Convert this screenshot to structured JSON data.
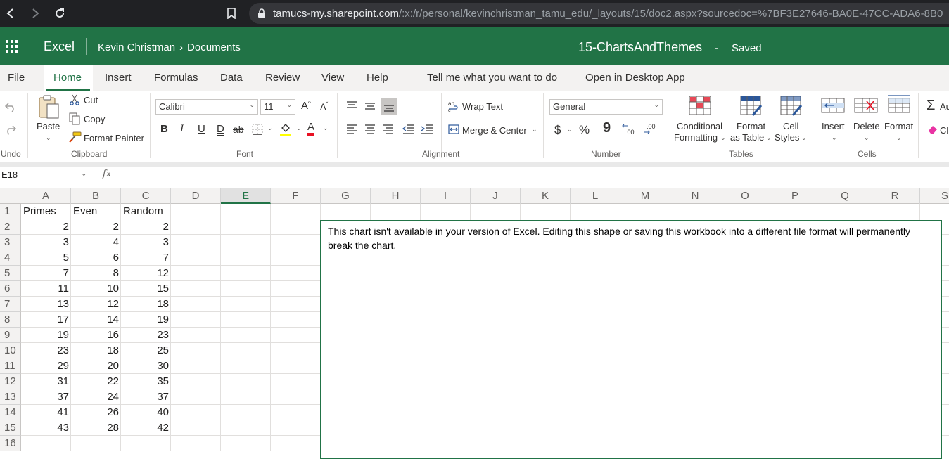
{
  "browser": {
    "url_host": "tamucs-my.sharepoint.com",
    "url_path": "/:x:/r/personal/kevinchristman_tamu_edu/_layouts/15/doc2.aspx?sourcedoc=%7BF3E27646-BA0E-47CC-ADA6-8B0"
  },
  "app": {
    "name": "Excel",
    "breadcrumb_user": "Kevin Christman",
    "breadcrumb_sep": "›",
    "breadcrumb_folder": "Documents",
    "doc_title": "15-ChartsAndThemes",
    "dash": "-",
    "save_status": "Saved"
  },
  "menu": {
    "tabs": [
      "File",
      "Home",
      "Insert",
      "Formulas",
      "Data",
      "Review",
      "View",
      "Help"
    ],
    "active": "Home",
    "tell_me": "Tell me what you want to do",
    "open_desktop": "Open in Desktop App"
  },
  "ribbon": {
    "undo_group": "Undo",
    "paste": "Paste",
    "cut": "Cut",
    "copy": "Copy",
    "format_painter": "Format Painter",
    "clipboard_group": "Clipboard",
    "font_name": "Calibri",
    "font_size": "11",
    "bold": "B",
    "italic": "I",
    "underline": "U",
    "double_underline": "D",
    "strike": "ab",
    "font_color_letter": "A",
    "font_group": "Font",
    "wrap_text": "Wrap Text",
    "merge_center": "Merge & Center",
    "alignment_group": "Alignment",
    "number_format": "General",
    "currency": "$",
    "percent": "%",
    "comma": "9",
    "number_group": "Number",
    "cond_format_1": "Conditional",
    "cond_format_2": "Formatting",
    "format_table_1": "Format",
    "format_table_2": "as Table",
    "cell_styles_1": "Cell",
    "cell_styles_2": "Styles",
    "tables_group": "Tables",
    "insert": "Insert",
    "delete": "Delete",
    "format": "Format",
    "cells_group": "Cells",
    "autosum": "Au",
    "clear": "Cl",
    "accent": "#217346"
  },
  "formula_bar": {
    "name_box": "E18",
    "fx": "fx",
    "formula": ""
  },
  "sheet": {
    "columns": [
      "A",
      "B",
      "C",
      "D",
      "E",
      "F",
      "G",
      "H",
      "I",
      "J",
      "K",
      "L",
      "M",
      "N",
      "O",
      "P",
      "Q",
      "R",
      "S"
    ],
    "selected_column": "E",
    "row_numbers": [
      "1",
      "2",
      "3",
      "4",
      "5",
      "6",
      "7",
      "8",
      "9",
      "10",
      "11",
      "12",
      "13",
      "14",
      "15",
      "16"
    ],
    "headers": [
      "Primes",
      "Even",
      "Random"
    ],
    "rows": [
      [
        "2",
        "2",
        "2"
      ],
      [
        "3",
        "4",
        "3"
      ],
      [
        "5",
        "6",
        "7"
      ],
      [
        "7",
        "8",
        "12"
      ],
      [
        "11",
        "10",
        "15"
      ],
      [
        "13",
        "12",
        "18"
      ],
      [
        "17",
        "14",
        "19"
      ],
      [
        "19",
        "16",
        "23"
      ],
      [
        "23",
        "18",
        "25"
      ],
      [
        "29",
        "20",
        "30"
      ],
      [
        "31",
        "22",
        "35"
      ],
      [
        "37",
        "24",
        "37"
      ],
      [
        "41",
        "26",
        "40"
      ],
      [
        "43",
        "28",
        "42"
      ]
    ]
  },
  "chart_placeholder": {
    "message": "This chart isn't available in your version of Excel. Editing this shape or saving this workbook into a different file format will permanently break the chart."
  }
}
